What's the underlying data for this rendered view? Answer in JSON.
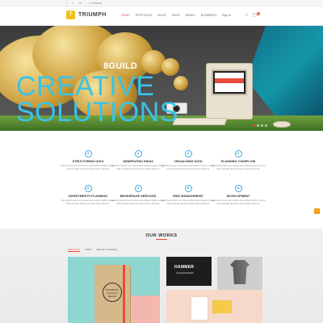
{
  "topbar": {
    "social": [
      "f",
      "t",
      "in"
    ],
    "search_label": "Search"
  },
  "header": {
    "logo_mark": "T",
    "logo_text": "TRIUMPH",
    "nav": [
      "Home",
      "Portfolio",
      "Blog",
      "Shop",
      "Pages",
      "Elements"
    ],
    "signin": "Sign in",
    "cart_count": "0"
  },
  "hero": {
    "brand": "8GUILD",
    "line1": "CREATIVE",
    "line2": "SOLUTIONS",
    "slides": 4,
    "active_slide": 1
  },
  "features": [
    {
      "title": "STRUCTURING DATA",
      "text": "Nam liber tempor cum soluta nobis eleifend option congue nihil imperdiet doming id quod mazim placerat."
    },
    {
      "title": "GENERATING IDEAS",
      "text": "Nam liber tempor cum soluta nobis eleifend option congue nihil imperdiet doming id quod mazim placerat."
    },
    {
      "title": "VISUALISING DATA",
      "text": "Nam liber tempor cum soluta nobis eleifend option congue nihil imperdiet doming id quod mazim placerat."
    },
    {
      "title": "PLANNING CASHFLOW",
      "text": "Nam liber tempor cum soluta nobis eleifend option congue nihil imperdiet doming id quod mazim placerat."
    },
    {
      "title": "INVESTMENTS PLANNING",
      "text": "Nam liber tempor cum soluta nobis eleifend option congue nihil imperdiet doming id quod mazim placerat."
    },
    {
      "title": "BROKERAGE SERVICES",
      "text": "Nam liber tempor cum soluta nobis eleifend option congue nihil imperdiet doming id quod mazim placerat."
    },
    {
      "title": "RISK MANAGEMENT",
      "text": "Nam liber tempor cum soluta nobis eleifend option congue nihil imperdiet doming id quod mazim placerat."
    },
    {
      "title": "DEVELOPMENT",
      "text": "Nam liber tempor cum soluta nobis eleifend option congue nihil imperdiet doming id quod mazim placerat."
    }
  ],
  "works": {
    "title": "OUR WORKS",
    "filters": [
      "Show All",
      "Apps",
      "Identity Design"
    ],
    "notebook_stamp": "NOTEBOOK MOCKUP BRAND",
    "poster_title": "HAMMER",
    "poster_sub": "ACCESSORIES"
  },
  "colors": {
    "accent": "#e84c3d",
    "hero_text": "#38c4e6",
    "icon": "#3aa9e0"
  },
  "icons": {
    "scroll_top": "chevron-up-icon",
    "search": "search-icon",
    "cart": "cart-icon"
  }
}
